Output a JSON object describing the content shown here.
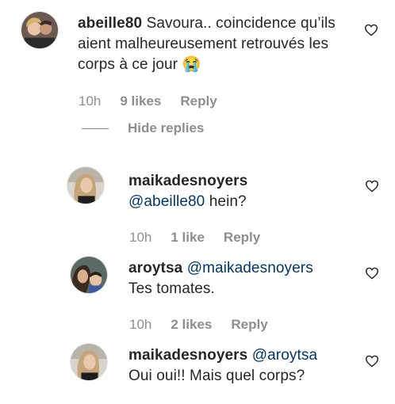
{
  "comments": [
    {
      "username": "abeille80",
      "text": "Savoura.. coincidence qu’ils aient malheureusement retrouvés les corps à ce jour 😭",
      "time": "10h",
      "likes": "9 likes",
      "reply_label": "Reply"
    },
    {
      "username": "maikadesnoyers",
      "mention": "@abeille80",
      "text": " hein?",
      "time": "10h",
      "likes": "1 like",
      "reply_label": "Reply"
    },
    {
      "username": "aroytsa",
      "mention": "@maikadesnoyers",
      "text": "Tes tomates.",
      "time": "10h",
      "likes": "2 likes",
      "reply_label": "Reply"
    },
    {
      "username": "maikadesnoyers",
      "mention": "@aroytsa",
      "text": "Oui oui!! Mais quel corps?",
      "time": "",
      "likes": "",
      "reply_label": ""
    }
  ],
  "hide_replies_label": "Hide replies",
  "colors": {
    "mention": "#00376b",
    "meta": "#8e8e8e",
    "text": "#262626"
  },
  "icons": {
    "like": "heart-outline-icon"
  }
}
